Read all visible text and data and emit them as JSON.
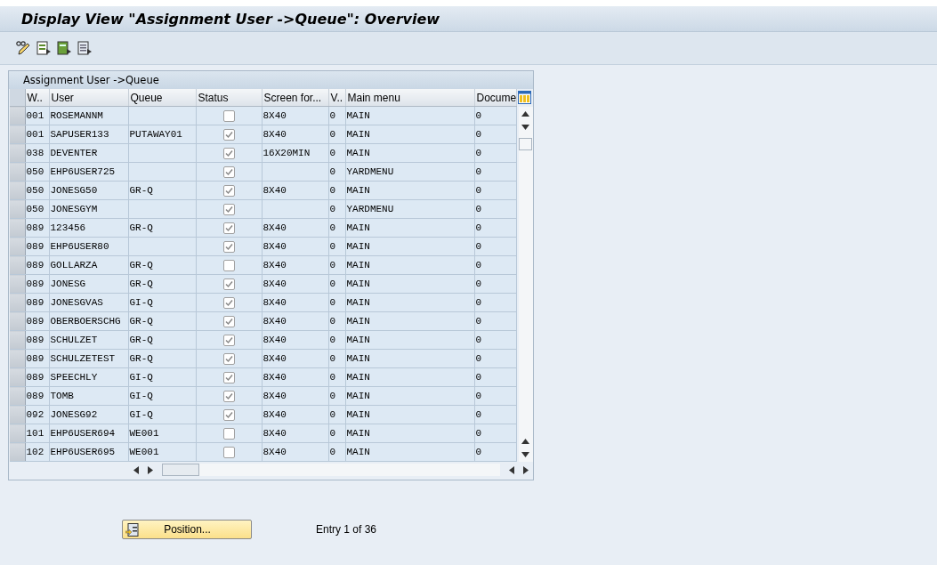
{
  "window": {
    "title": "Display View \"Assignment User ->Queue\": Overview"
  },
  "table": {
    "title": "Assignment User ->Queue",
    "columns": [
      "W..",
      "User",
      "Queue",
      "Status",
      "Screen for...",
      "V..",
      "Main menu",
      "Docume"
    ],
    "rows": [
      {
        "w": "001",
        "user": "ROSEMANNM",
        "status": false,
        "screen": "8X40",
        "v": "0",
        "main_menu": "MAIN",
        "document": "0"
      },
      {
        "w": "001",
        "user": "SAPUSER133",
        "queue": "PUTAWAY01",
        "status": true,
        "screen": "8X40",
        "v": "0",
        "main_menu": "MAIN",
        "document": "0"
      },
      {
        "w": "038",
        "user": "DEVENTER",
        "status": true,
        "screen": "16X20MIN",
        "v": "0",
        "main_menu": "MAIN",
        "document": "0"
      },
      {
        "w": "050",
        "user": "EHP6USER725",
        "status": true,
        "v": "0",
        "main_menu": "YARDMENU",
        "document": "0"
      },
      {
        "w": "050",
        "user": "JONESG50",
        "queue": "GR-Q",
        "status": true,
        "screen": "8X40",
        "v": "0",
        "main_menu": "MAIN",
        "document": "0"
      },
      {
        "w": "050",
        "user": "JONESGYM",
        "status": true,
        "v": "0",
        "main_menu": "YARDMENU",
        "document": "0"
      },
      {
        "w": "089",
        "user": "123456",
        "queue": "GR-Q",
        "status": true,
        "screen": "8X40",
        "v": "0",
        "main_menu": "MAIN",
        "document": "0"
      },
      {
        "w": "089",
        "user": "EHP6USER80",
        "status": true,
        "screen": "8X40",
        "v": "0",
        "main_menu": "MAIN",
        "document": "0"
      },
      {
        "w": "089",
        "user": "GOLLARZA",
        "queue": "GR-Q",
        "status": false,
        "screen": "8X40",
        "v": "0",
        "main_menu": "MAIN",
        "document": "0"
      },
      {
        "w": "089",
        "user": "JONESG",
        "queue": "GR-Q",
        "status": true,
        "screen": "8X40",
        "v": "0",
        "main_menu": "MAIN",
        "document": "0"
      },
      {
        "w": "089",
        "user": "JONESGVAS",
        "queue": "GI-Q",
        "status": true,
        "screen": "8X40",
        "v": "0",
        "main_menu": "MAIN",
        "document": "0"
      },
      {
        "w": "089",
        "user": "OBERBOERSCHG",
        "queue": "GR-Q",
        "status": true,
        "screen": "8X40",
        "v": "0",
        "main_menu": "MAIN",
        "document": "0"
      },
      {
        "w": "089",
        "user": "SCHULZET",
        "queue": "GR-Q",
        "status": true,
        "screen": "8X40",
        "v": "0",
        "main_menu": "MAIN",
        "document": "0"
      },
      {
        "w": "089",
        "user": "SCHULZETEST",
        "queue": "GR-Q",
        "status": true,
        "screen": "8X40",
        "v": "0",
        "main_menu": "MAIN",
        "document": "0"
      },
      {
        "w": "089",
        "user": "SPEECHLY",
        "queue": "GI-Q",
        "status": true,
        "screen": "8X40",
        "v": "0",
        "main_menu": "MAIN",
        "document": "0"
      },
      {
        "w": "089",
        "user": "TOMB",
        "queue": "GI-Q",
        "status": true,
        "screen": "8X40",
        "v": "0",
        "main_menu": "MAIN",
        "document": "0"
      },
      {
        "w": "092",
        "user": "JONESG92",
        "queue": "GI-Q",
        "status": true,
        "screen": "8X40",
        "v": "0",
        "main_menu": "MAIN",
        "document": "0"
      },
      {
        "w": "101",
        "user": "EHP6USER694",
        "queue": "WE001",
        "status": false,
        "screen": "8X40",
        "v": "0",
        "main_menu": "MAIN",
        "document": "0"
      },
      {
        "w": "102",
        "user": "EHP6USER695",
        "queue": "WE001",
        "status": false,
        "screen": "8X40",
        "v": "0",
        "main_menu": "MAIN",
        "document": "0"
      }
    ]
  },
  "footer": {
    "position_button": "Position...",
    "entry_text": "Entry 1 of 36"
  }
}
